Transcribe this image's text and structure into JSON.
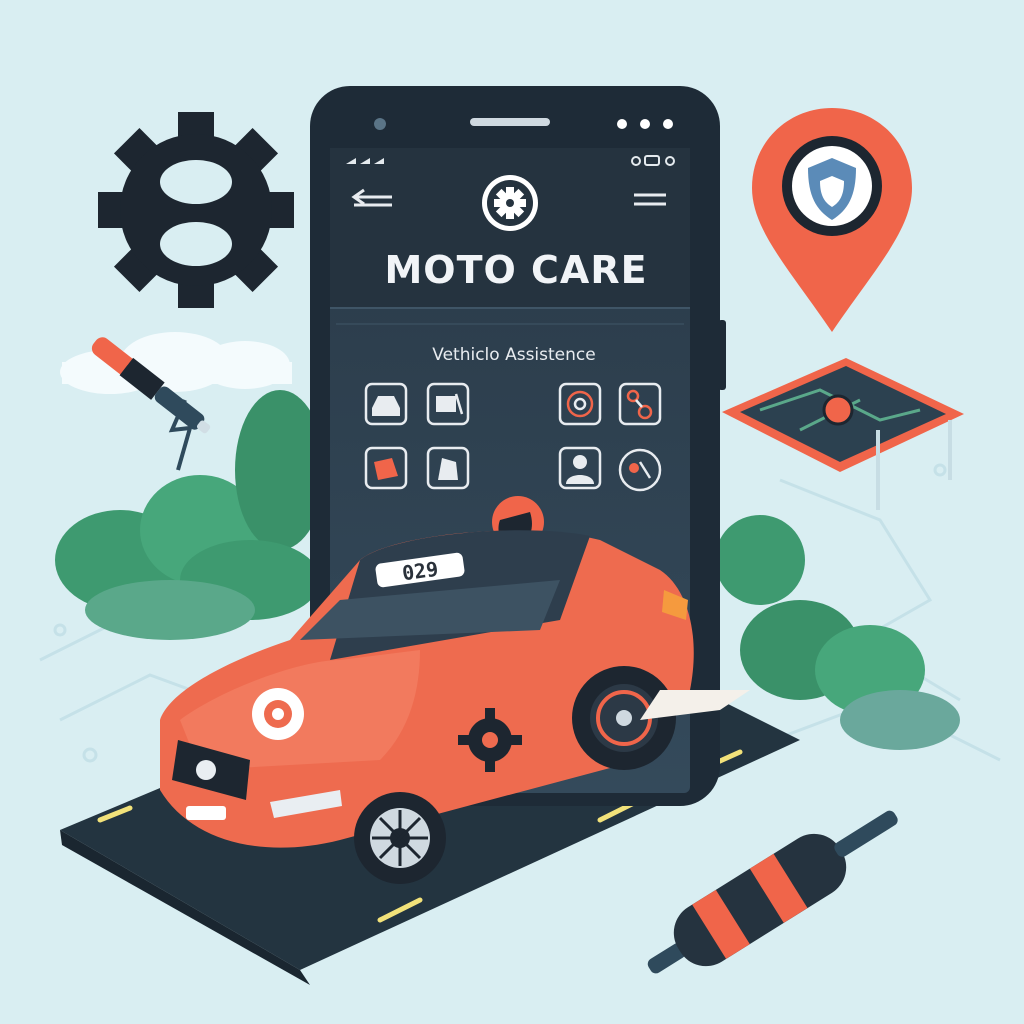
{
  "app": {
    "title": "MOTO CARE",
    "subtitle": "Vethiclo Assistence"
  },
  "vehicle": {
    "plate_text": "029"
  },
  "icons": {
    "hero": "gear-logo-icon",
    "status_bar": [
      "signal-icon",
      "battery-icon"
    ],
    "left_nav": "back-arrow-icon",
    "right_nav": "hamburger-menu-icon",
    "services": [
      "car-front-icon",
      "tow-truck-icon",
      "engine-icon",
      "wrench-icon",
      "tire-icon",
      "phone-service-icon",
      "person-icon",
      "location-icon"
    ],
    "scene": [
      "large-gear-icon",
      "map-pin-shield-icon",
      "screwdriver-icon",
      "spark-plug-icon",
      "map-card-icon"
    ]
  },
  "colors": {
    "background": "#d9eef2",
    "phone_body": "#1e2b37",
    "phone_screen": "#2b3a48",
    "accent_orange": "#f0654a",
    "road": "#233440",
    "road_marking": "#f2e27a",
    "foliage": "#3e9a70",
    "gear": "#1d2630"
  }
}
